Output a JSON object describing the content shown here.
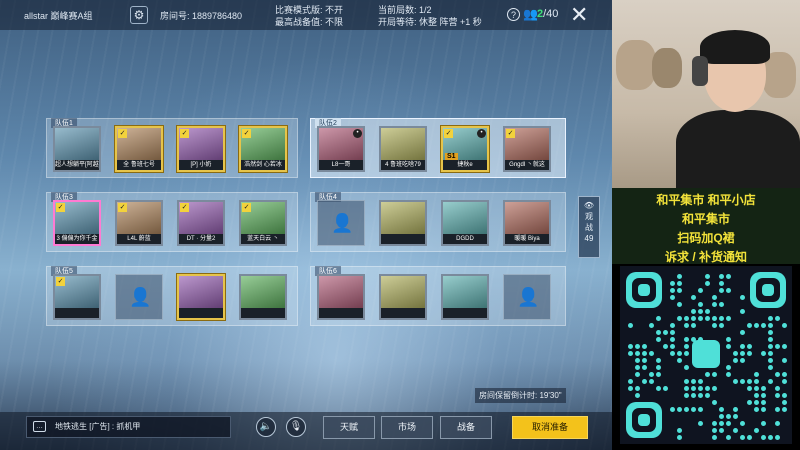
{
  "topbar": {
    "room_name": "allstar 巅峰赛A组",
    "room_no": "房间号: 1889786480",
    "mode_line1": "比赛模式版: 不开",
    "mode_line2": "最高战备值: 不限",
    "players_line1": "当前局数: 1/2",
    "players_line2": "开局等待: 休整 阵营 +1 秒",
    "help_icon": "question-icon",
    "count_current": "2",
    "count_total": "/40"
  },
  "teams": [
    {
      "label": "队伍1",
      "highlight": false,
      "slots": [
        {
          "name": "超人想躺平[阿越]",
          "frame": "plain",
          "check": false
        },
        {
          "name": "全 鲁班七号",
          "frame": "gold",
          "check": true
        },
        {
          "name": "[P] 小奶",
          "frame": "gold",
          "check": true
        },
        {
          "name": "浩然剑 心若冰",
          "frame": "gold",
          "check": true
        }
      ]
    },
    {
      "label": "队伍2",
      "highlight": true,
      "slots": [
        {
          "name": "L8一哥",
          "frame": "plain",
          "check": false,
          "mic": true
        },
        {
          "name": "4 鲁班吃啥79",
          "frame": "plain",
          "check": false
        },
        {
          "name": "捷秋e",
          "frame": "gold",
          "check": true,
          "mic": true,
          "tag": "S1"
        },
        {
          "name": "Gngdl 丶就这",
          "frame": "plain",
          "check": true
        }
      ]
    },
    {
      "label": "队伍3",
      "highlight": false,
      "slots": [
        {
          "name": "3 偏偏为你千金",
          "frame": "pink",
          "check": true
        },
        {
          "name": "L4L 蔚蓝",
          "frame": "plain",
          "check": true
        },
        {
          "name": "DT · 分量2",
          "frame": "plain",
          "check": true
        },
        {
          "name": "蓝天白云 丶",
          "frame": "plain",
          "check": true
        }
      ]
    },
    {
      "label": "队伍4",
      "highlight": false,
      "slots": [
        {
          "name": "",
          "frame": "empty"
        },
        {
          "name": "",
          "frame": "plain",
          "check": false
        },
        {
          "name": "DGDD",
          "frame": "plain",
          "check": false
        },
        {
          "name": "暖暖 Biya",
          "frame": "plain",
          "check": false
        }
      ]
    },
    {
      "label": "队伍5",
      "highlight": false,
      "slots": [
        {
          "name": "",
          "frame": "plain",
          "check": true
        },
        {
          "name": "",
          "frame": "empty"
        },
        {
          "name": "",
          "frame": "gold",
          "check": false
        },
        {
          "name": "",
          "frame": "plain",
          "check": false
        }
      ]
    },
    {
      "label": "队伍6",
      "highlight": false,
      "slots": [
        {
          "name": "",
          "frame": "plain",
          "check": false
        },
        {
          "name": "",
          "frame": "plain",
          "check": false
        },
        {
          "name": "",
          "frame": "plain",
          "check": false
        },
        {
          "name": "",
          "frame": "empty"
        }
      ]
    }
  ],
  "spectate": {
    "label1": "观",
    "label2": "战",
    "count": "49"
  },
  "timer": "房间保留倒计时: 19'30\"",
  "chat": {
    "icon": "chat-icon",
    "text": "地铁逃生 [广告] : 抓机甲"
  },
  "buttons": {
    "voice": "speaker-icon",
    "mic": "mic-icon",
    "talent": "天赋",
    "market": "市场",
    "prepare": "战备",
    "cancel_ready": "取消准备"
  },
  "stream": {
    "banner_line1": "和平集市  和平小店",
    "banner_line2": "和平集市",
    "banner_line3": "扫码加Q裙",
    "banner_line4": "诉求 / 补货通知"
  },
  "colors": {
    "accent": "#f3c21b",
    "gold_frame": "#e6c44a",
    "qr_cyan": "#4fe0d8",
    "banner_text": "#f2e23a"
  }
}
